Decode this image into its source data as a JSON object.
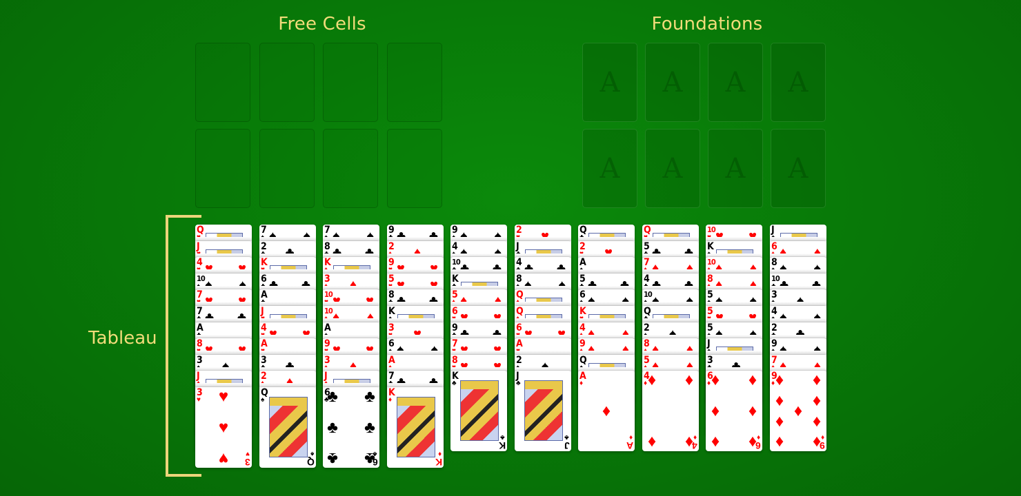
{
  "labels": {
    "free_cells": "Free Cells",
    "foundations": "Foundations",
    "tableau": "Tableau"
  },
  "free_cells": [
    {
      "card": null
    },
    {
      "card": null
    },
    {
      "card": null
    },
    {
      "card": null
    },
    {
      "card": null
    },
    {
      "card": null
    },
    {
      "card": null
    },
    {
      "card": null
    }
  ],
  "foundations": [
    {
      "placeholder": "A",
      "card": null
    },
    {
      "placeholder": "A",
      "card": null
    },
    {
      "placeholder": "A",
      "card": null
    },
    {
      "placeholder": "A",
      "card": null
    },
    {
      "placeholder": "A",
      "card": null
    },
    {
      "placeholder": "A",
      "card": null
    },
    {
      "placeholder": "A",
      "card": null
    },
    {
      "placeholder": "A",
      "card": null
    }
  ],
  "colors": {
    "felt": "#087a08",
    "label": "#f1dc7a",
    "red_suit": "#ff0000",
    "black_suit": "#000000"
  },
  "tableau": [
    [
      "Q♥",
      "J♥",
      "4♥",
      "10♠",
      "7♥",
      "7♣",
      "A♣",
      "8♥",
      "3♠",
      "J♦",
      "3♥"
    ],
    [
      "7♠",
      "2♣",
      "K♥",
      "6♣",
      "A♣",
      "J♥",
      "4♥",
      "A♥",
      "3♣",
      "2♦",
      "Q♠"
    ],
    [
      "7♠",
      "8♣",
      "K♦",
      "3♦",
      "10♥",
      "10♦",
      "A♠",
      "9♥",
      "3♦",
      "J♦",
      "6♣"
    ],
    [
      "9♣",
      "2♦",
      "9♥",
      "5♥",
      "8♣",
      "K♠",
      "3♥",
      "6♠",
      "A♦",
      "7♣",
      "K♦"
    ],
    [
      "9♠",
      "4♠",
      "10♣",
      "K♣",
      "5♦",
      "6♥",
      "9♣",
      "7♥",
      "8♥",
      "K♣"
    ],
    [
      "2♥",
      "J♣",
      "4♣",
      "8♠",
      "Q♦",
      "Q♦",
      "6♥",
      "A♥",
      "2♠",
      "J♣"
    ],
    [
      "Q♣",
      "2♥",
      "A♠",
      "5♣",
      "6♠",
      "K♥",
      "4♦",
      "9♦",
      "Q♠",
      "A♦"
    ],
    [
      "Q♥",
      "5♣",
      "7♦",
      "4♣",
      "10♠",
      "Q♣",
      "2♠",
      "8♦",
      "5♦",
      "4♦"
    ],
    [
      "10♥",
      "K♠",
      "10♦",
      "8♦",
      "5♠",
      "5♥",
      "5♠",
      "J♠",
      "3♣",
      "6♦"
    ],
    [
      "J♠",
      "6♦",
      "8♠",
      "10♣",
      "3♠",
      "4♠",
      "2♣",
      "9♠",
      "7♦",
      "9♦"
    ]
  ]
}
